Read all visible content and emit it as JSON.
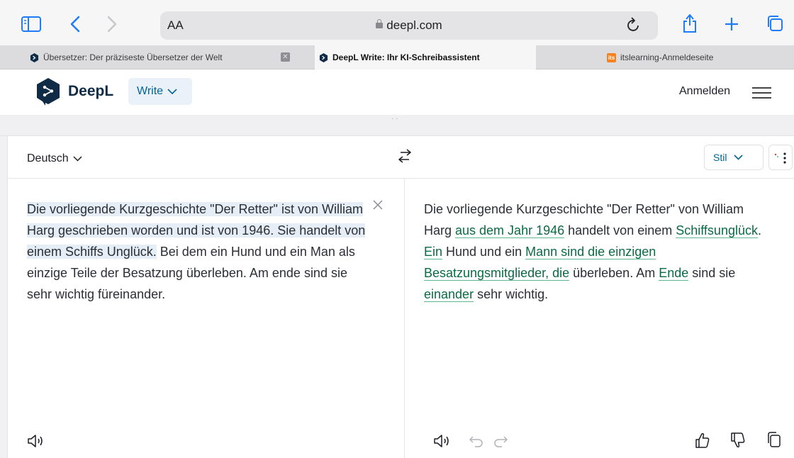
{
  "browser": {
    "text_size_label": "AA",
    "domain": "deepl.com",
    "tabs": [
      {
        "title": "Übersetzer: Der präziseste Übersetzer der Welt"
      },
      {
        "title": "DeepL Write: Ihr KI-Schreibassistent"
      },
      {
        "title": "itslearning-Anmeldeseite",
        "favicon_text": "its"
      }
    ]
  },
  "header": {
    "brand": "DeepL",
    "product_label": "Write",
    "login_label": "Anmelden"
  },
  "editor": {
    "language": "Deutsch",
    "style_label": "Stil",
    "source": {
      "highlighted": "Die vorliegende Kurzgeschichte \"Der Retter\" ist von William Harg geschrieben worden und ist von 1946. Sie handelt von einem Schiffs Unglück.",
      "rest": " Bei dem ein Hund und ein Man als einzige Teile der Besatzung überleben. Am ende sind sie sehr wichtig füreinander."
    },
    "target": {
      "segments": [
        {
          "text": "Die vorliegende Kurzgeschichte \"Der Retter\" von William Harg ",
          "changed": false
        },
        {
          "text": "aus dem Jahr 1946",
          "changed": true
        },
        {
          "text": " handelt von einem ",
          "changed": false
        },
        {
          "text": "Schiffsunglück",
          "changed": true
        },
        {
          "text": ". ",
          "changed": false
        },
        {
          "text": "Ein",
          "changed": true
        },
        {
          "text": " Hund und ein ",
          "changed": false
        },
        {
          "text": "Mann sind die einzigen Besatzungsmitglieder, die",
          "changed": true
        },
        {
          "text": " überleben. Am ",
          "changed": false
        },
        {
          "text": "Ende",
          "changed": true
        },
        {
          "text": " sind sie ",
          "changed": false
        },
        {
          "text": "einander",
          "changed": true
        },
        {
          "text": " sehr wichtig.",
          "changed": false
        }
      ]
    }
  },
  "colors": {
    "accent": "#1f7cf6",
    "deepl_navy": "#0f2b46",
    "deepl_blue": "#006494",
    "change_green": "#0b6b45",
    "highlight": "#e5edf6"
  }
}
